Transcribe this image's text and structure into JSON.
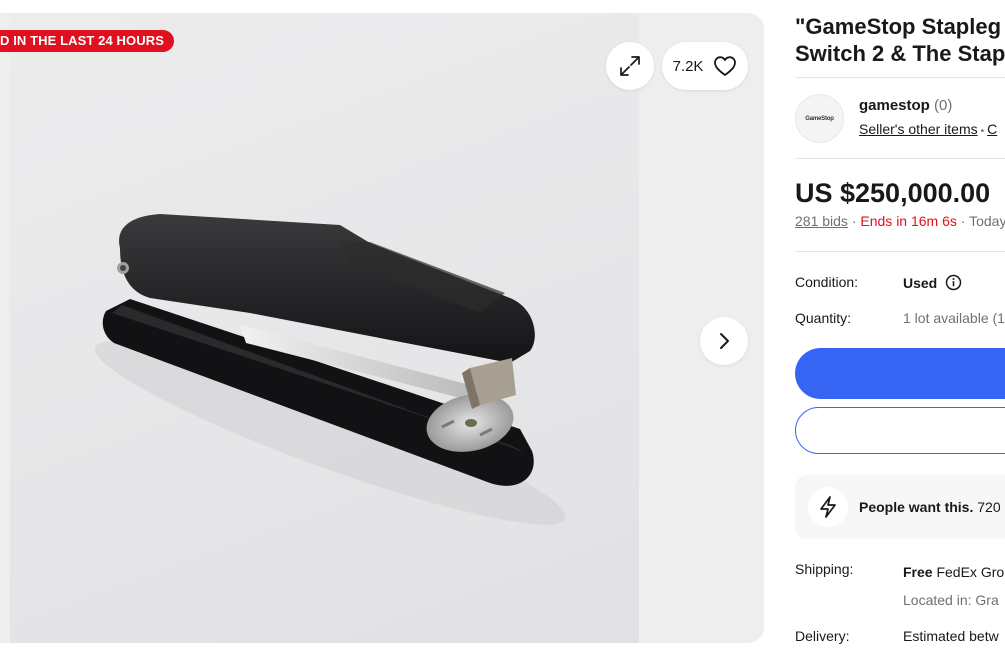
{
  "gallery": {
    "sold_badge": "D IN THE LAST 24 HOURS",
    "watch_count": "7.2K"
  },
  "listing": {
    "title_line1": "\"GameStop Stapleg",
    "title_line2": "Switch 2 & The Stap"
  },
  "seller": {
    "logo_text": "GameStop",
    "name": "gamestop",
    "feedback": "(0)",
    "other_items_label": "Seller's other items",
    "contact_label": "C"
  },
  "pricing": {
    "price": "US $250,000.00",
    "bids": "281 bids",
    "ends": "Ends in 16m 6s",
    "ends_when": "Today"
  },
  "specs": {
    "condition_label": "Condition:",
    "condition_value": "Used",
    "quantity_label": "Quantity:",
    "quantity_value": "1 lot available (1"
  },
  "promo": {
    "bold": "People want this.",
    "rest": "720"
  },
  "shipping": {
    "label": "Shipping:",
    "free": "Free",
    "method": "FedEx Gro",
    "location": "Located in: Gra",
    "delivery_label": "Delivery:",
    "delivery_value": "Estimated betw"
  },
  "colors": {
    "accent": "#3665f3",
    "urgent": "#e0101f",
    "text": "#191919",
    "muted": "#707070"
  }
}
